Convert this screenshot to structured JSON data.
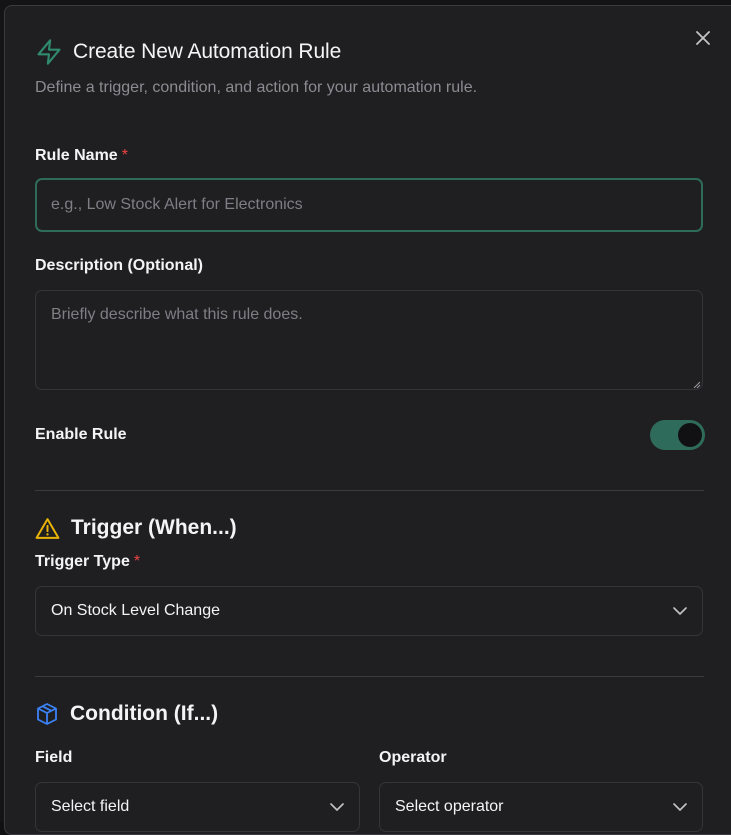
{
  "dialog": {
    "title": "Create New Automation Rule",
    "subtitle": "Define a trigger, condition, and action for your automation rule.",
    "title_icon": "lightning-icon",
    "close_icon": "close-icon"
  },
  "rule_name": {
    "label": "Rule Name",
    "required_mark": "*",
    "placeholder": "e.g., Low Stock Alert for Electronics",
    "value": ""
  },
  "description": {
    "label": "Description (Optional)",
    "placeholder": "Briefly describe what this rule does.",
    "value": ""
  },
  "enable_rule": {
    "label": "Enable Rule",
    "enabled": true
  },
  "trigger": {
    "title": "Trigger (When...)",
    "icon": "warning-icon",
    "type_label": "Trigger Type",
    "required_mark": "*",
    "selected": "On Stock Level Change"
  },
  "condition": {
    "title": "Condition (If...)",
    "icon": "box-icon",
    "field_label": "Field",
    "field_selected": "Select field",
    "operator_label": "Operator",
    "operator_selected": "Select operator"
  },
  "colors": {
    "accent": "#2f6b5a",
    "warning": "#eab308",
    "condition_icon": "#3b82f6",
    "required": "#ef4444",
    "background": "#1f1f22"
  }
}
